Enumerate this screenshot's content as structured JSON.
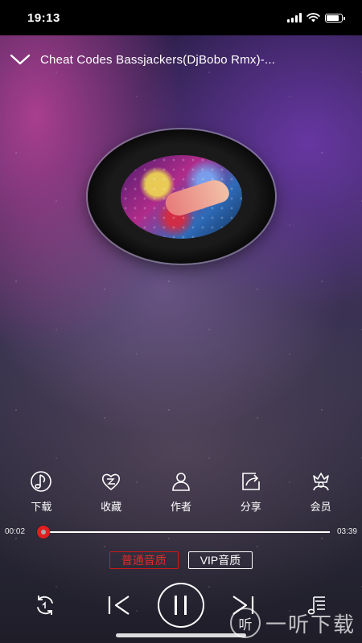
{
  "status_bar": {
    "time": "19:13"
  },
  "header": {
    "title": "Cheat Codes Bassjackers(DjBobo Rmx)-..."
  },
  "actions": [
    {
      "label": "下载",
      "icon": "download-note-icon"
    },
    {
      "label": "收藏",
      "icon": "favorite-heart-icon"
    },
    {
      "label": "作者",
      "icon": "author-person-icon"
    },
    {
      "label": "分享",
      "icon": "share-icon"
    },
    {
      "label": "会员",
      "icon": "vip-crown-icon"
    }
  ],
  "progress": {
    "current": "00:02",
    "total": "03:39",
    "fraction": 0.01
  },
  "quality": {
    "standard": "普通音质",
    "vip": "VIP音质",
    "selected": "standard"
  },
  "watermark": {
    "circle": "听",
    "text": "一听下载"
  },
  "colors": {
    "accent": "#e02020"
  }
}
